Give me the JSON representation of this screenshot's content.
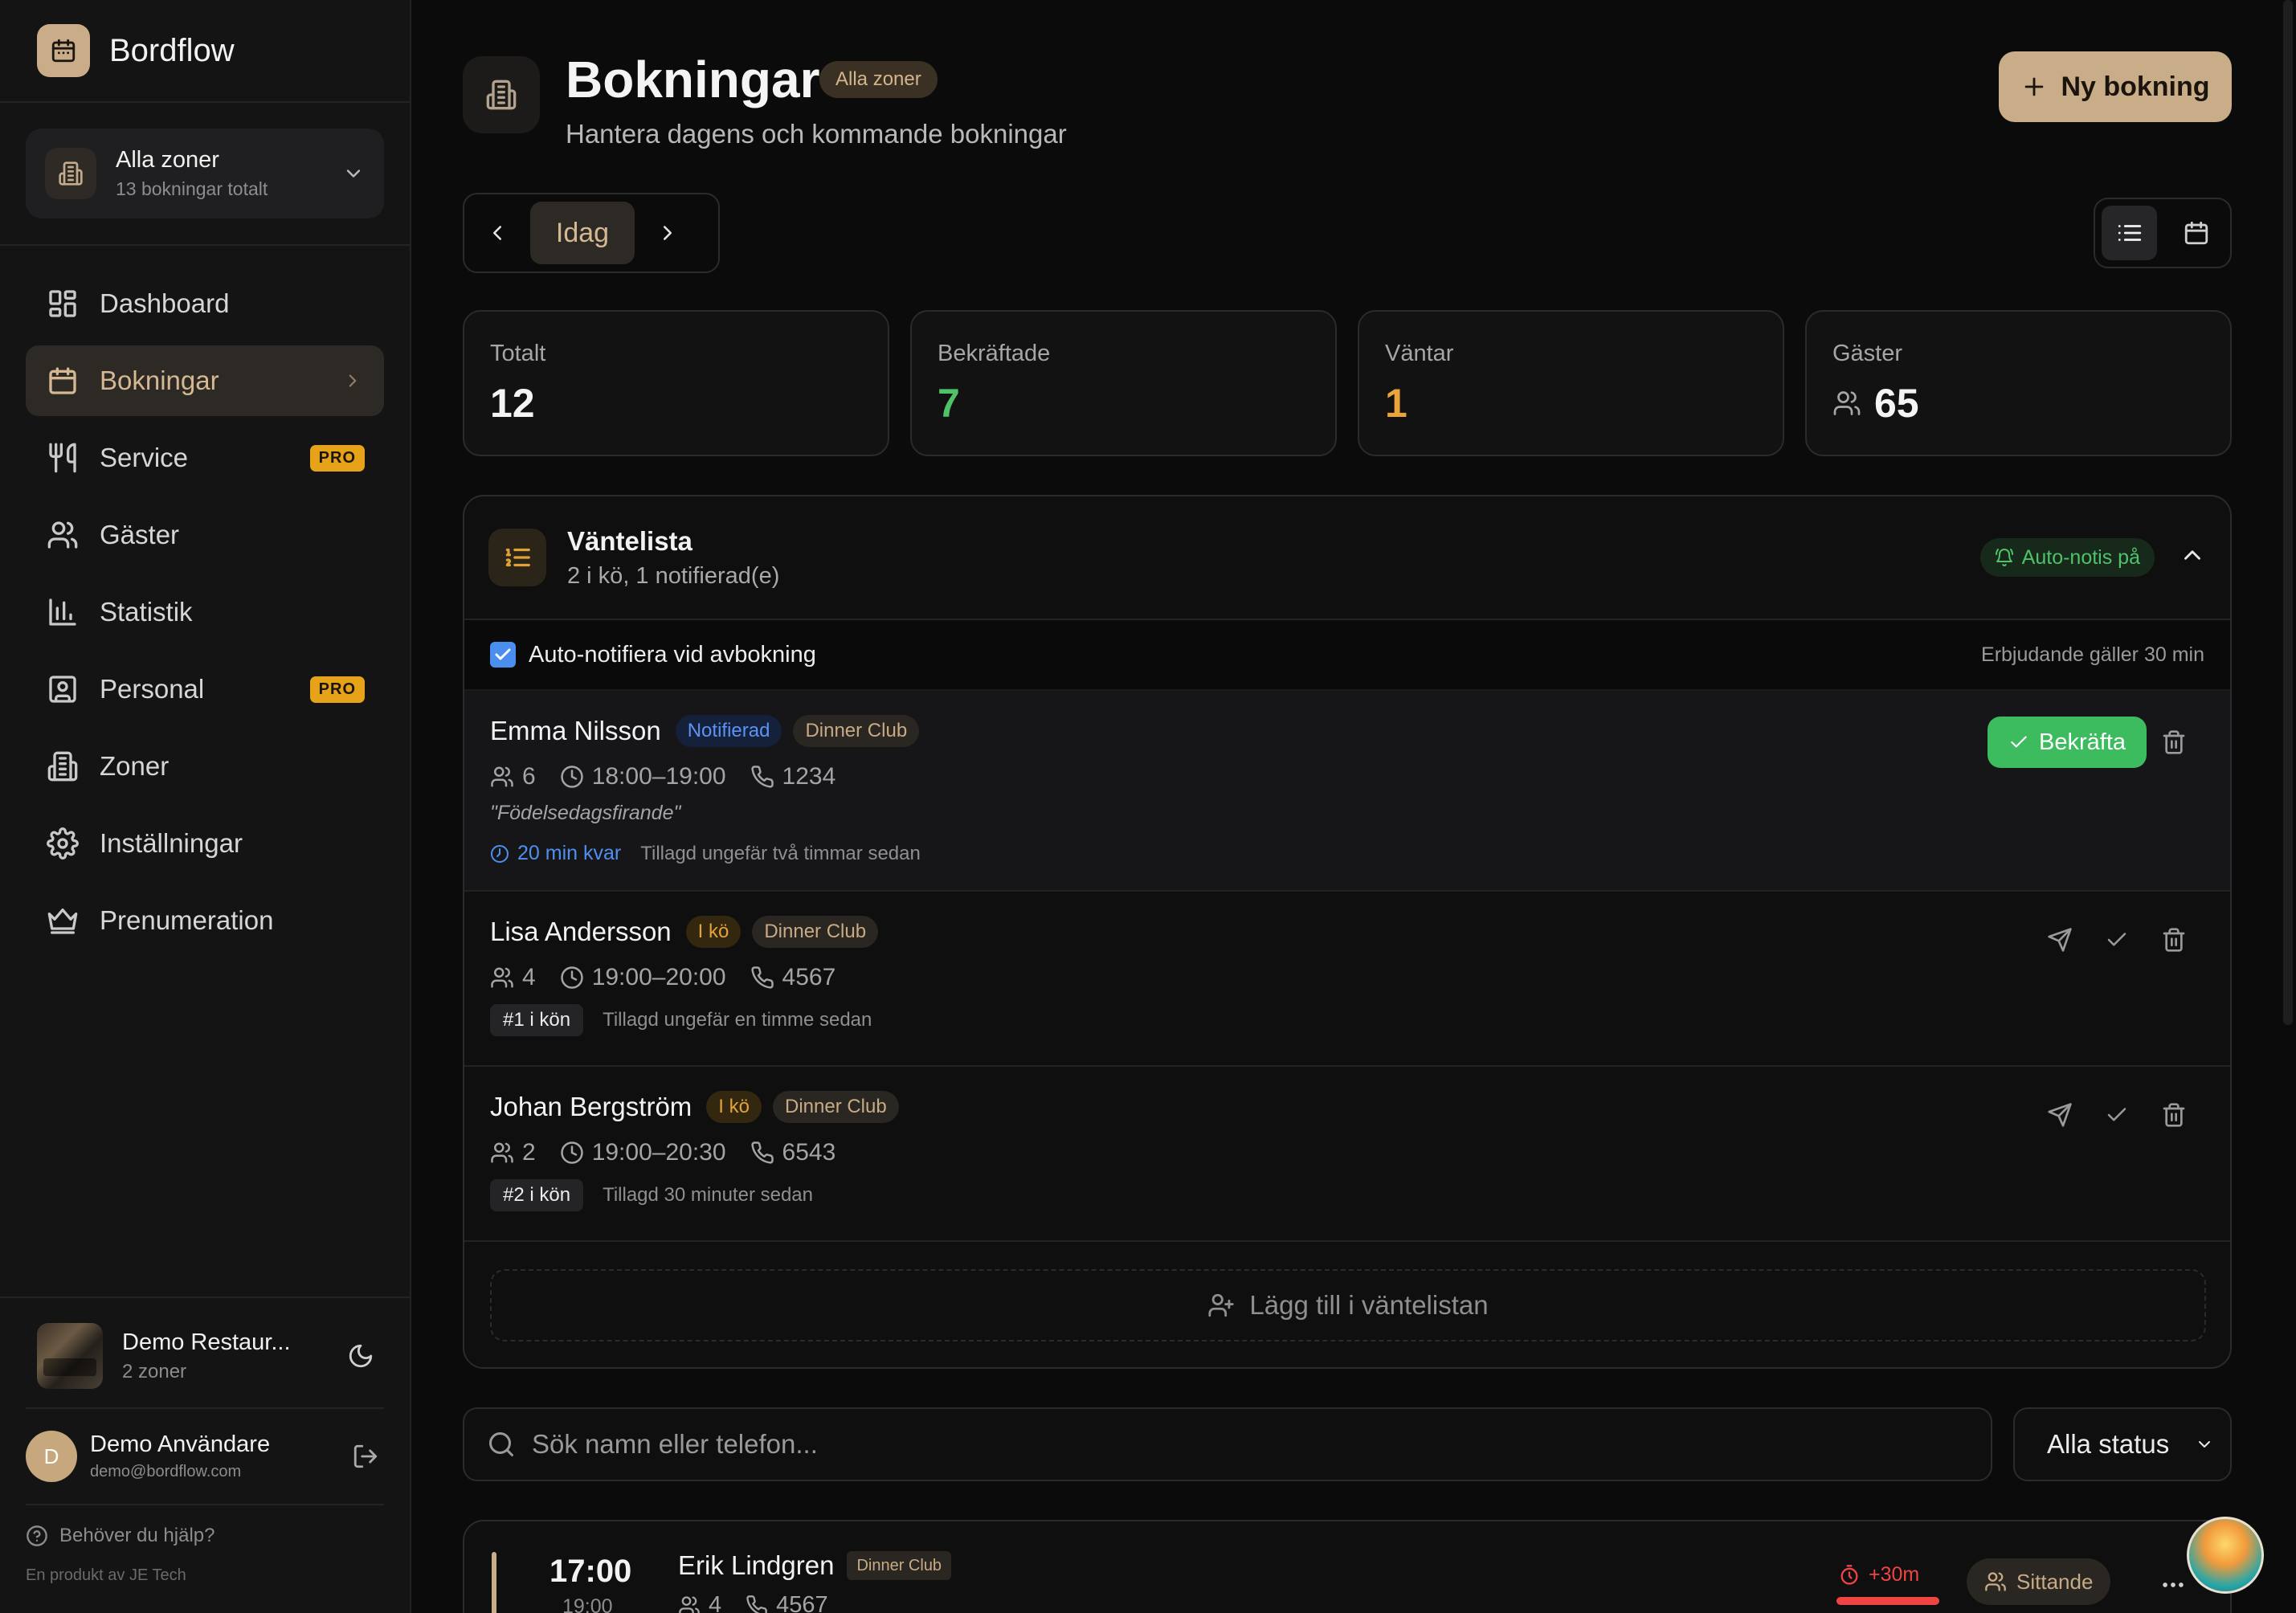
{
  "app": {
    "name": "Bordflow"
  },
  "zone_selector": {
    "name": "Alla zoner",
    "sub": "13 bokningar totalt"
  },
  "nav": [
    {
      "label": "Dashboard",
      "icon": "dashboard-icon"
    },
    {
      "label": "Bokningar",
      "icon": "calendar-icon",
      "active": true
    },
    {
      "label": "Service",
      "icon": "utensils-icon",
      "badge": "PRO"
    },
    {
      "label": "Gäster",
      "icon": "users-icon"
    },
    {
      "label": "Statistik",
      "icon": "bar-chart-icon"
    },
    {
      "label": "Personal",
      "icon": "id-badge-icon",
      "badge": "PRO"
    },
    {
      "label": "Zoner",
      "icon": "building-icon"
    },
    {
      "label": "Inställningar",
      "icon": "gear-icon"
    },
    {
      "label": "Prenumeration",
      "icon": "crown-icon"
    }
  ],
  "restaurant": {
    "name": "Demo Restaur...",
    "sub": "2 zoner"
  },
  "user": {
    "initial": "D",
    "name": "Demo Användare",
    "email": "demo@bordflow.com"
  },
  "help": {
    "label": "Behöver du hjälp?"
  },
  "credit": "En produkt av JE Tech",
  "header": {
    "title": "Bokningar",
    "zone_chip": "Alla zoner",
    "subtitle": "Hantera dagens och kommande bokningar",
    "new_button": "Ny bokning"
  },
  "date_nav": {
    "today": "Idag"
  },
  "stats": [
    {
      "label": "Totalt",
      "value": "12",
      "color": "#f4f4f4"
    },
    {
      "label": "Bekräftade",
      "value": "7",
      "color": "#4fc26a"
    },
    {
      "label": "Väntar",
      "value": "1",
      "color": "#e9a43b"
    },
    {
      "label": "Gäster",
      "value": "65",
      "color": "#f4f4f4"
    }
  ],
  "waitlist": {
    "title": "Väntelista",
    "subtitle": "2 i kö, 1 notifierad(e)",
    "auto_chip": "Auto-notis på",
    "auto_notify_label": "Auto-notifiera vid avbokning",
    "auto_notify_checked": true,
    "offer_note": "Erbjudande gäller 30 min",
    "entries": [
      {
        "name": "Emma Nilsson",
        "status": "Notifierad",
        "zone": "Dinner Club",
        "guests": "6",
        "time": "18:00–19:00",
        "phone": "1234",
        "note": "\"Födelsedagsfirande\"",
        "remaining": "20 min kvar",
        "added": "Tillagd ungefär två timmar sedan",
        "confirm_label": "Bekräfta"
      },
      {
        "name": "Lisa Andersson",
        "status": "I kö",
        "zone": "Dinner Club",
        "guests": "4",
        "time": "19:00–20:00",
        "phone": "4567",
        "position": "#1 i kön",
        "added": "Tillagd ungefär en timme sedan"
      },
      {
        "name": "Johan Bergström",
        "status": "I kö",
        "zone": "Dinner Club",
        "guests": "2",
        "time": "19:00–20:30",
        "phone": "6543",
        "position": "#2 i kön",
        "added": "Tillagd 30 minuter sedan"
      }
    ],
    "add_label": "Lägg till i väntelistan"
  },
  "filters": {
    "search_placeholder": "Sök namn eller telefon...",
    "status_value": "Alla status"
  },
  "booking": {
    "time": "17:00",
    "end_time": "19:00",
    "name": "Erik Lindgren",
    "zone": "Dinner Club",
    "guests": "4",
    "phone": "4567",
    "overdue": "+30m",
    "status": "Sittande"
  },
  "colors": {
    "accent": "#c9ad88",
    "success": "#3dbb5f",
    "warning": "#e4a23a",
    "info": "#4f8ff0",
    "danger": "#ef4444"
  }
}
